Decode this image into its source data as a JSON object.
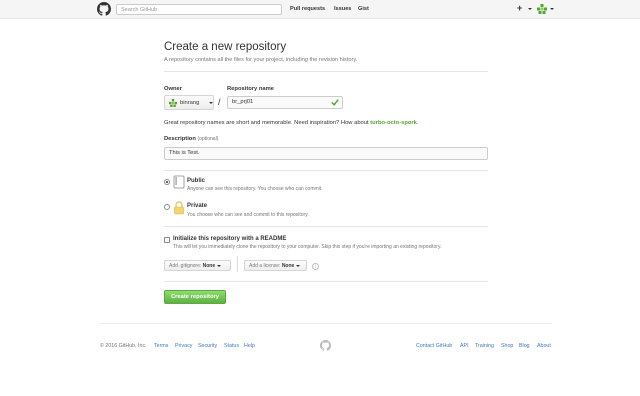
{
  "header": {
    "search_placeholder": "Search GitHub",
    "nav": [
      "Pull requests",
      "Issues",
      "Gist"
    ],
    "plus": "+"
  },
  "page": {
    "title": "Create a new repository",
    "subtitle": "A repository contains all the files for your project, including the revision history."
  },
  "form": {
    "owner_label": "Owner",
    "owner_value": "binrang",
    "slash": "/",
    "repo_label": "Repository name",
    "repo_value": "br_prj01",
    "suggestion_prefix": "Great repository names are short and memorable. Need inspiration? How about ",
    "suggestion_name": "turbo-octo-spork",
    "suggestion_suffix": ".",
    "description_label": "Description",
    "description_optional": "(optional)",
    "description_value": "This is Test.",
    "visibility": [
      {
        "title": "Public",
        "note": "Anyone can see this repository. You choose who can commit.",
        "selected": true
      },
      {
        "title": "Private",
        "note": "You choose who can see and commit to this repository.",
        "selected": false
      }
    ],
    "readme_label": "Initialize this repository with a README",
    "readme_note": "This will let you immediately clone the repository to your computer. Skip this step if you're importing an existing repository.",
    "gitignore_prefix": "Add .gitignore:",
    "gitignore_value": "None",
    "license_prefix": "Add a license:",
    "license_value": "None",
    "info": "i",
    "create_button": "Create repository"
  },
  "footer": {
    "copyright": "© 2016 GitHub, Inc.",
    "left_links": [
      "Terms",
      "Privacy",
      "Security",
      "Status",
      "Help"
    ],
    "right_links": [
      "Contact GitHub",
      "API",
      "Training",
      "Shop",
      "Blog",
      "About"
    ]
  },
  "colors": {
    "accent_green": "#60b044",
    "link_blue": "#4078c0"
  }
}
